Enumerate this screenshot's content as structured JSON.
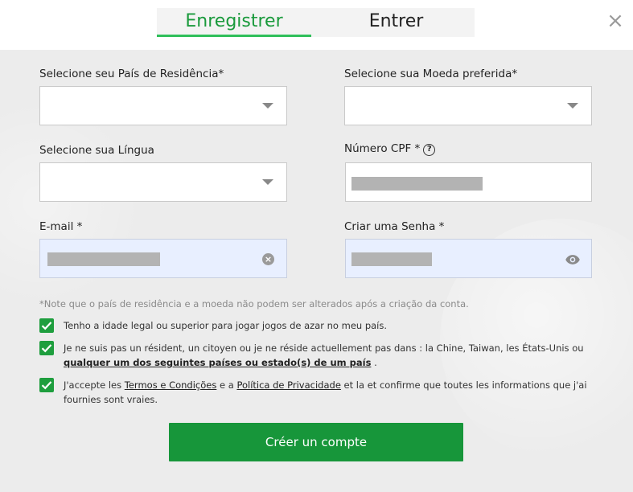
{
  "tabs": {
    "register": "Enregistrer",
    "login": "Entrer"
  },
  "close_symbol": "×",
  "form": {
    "country_label": "Selecione seu País de Residência*",
    "currency_label": "Selecione sua Moeda preferida*",
    "language_label": "Selecione sua Língua",
    "cpf_label": "Número CPF *",
    "cpf_help": "?",
    "email_label": "E-mail *",
    "password_label": "Criar uma Senha *",
    "clear_symbol": "×"
  },
  "note": "*Note que o país de residência e a moeda não podem ser alterados após a criação da conta.",
  "checks": {
    "age": "Tenho a idade legal ou superior para jogar jogos de azar no meu país.",
    "resident_prefix": "Je ne suis pas un résident, un citoyen ou je ne réside actuellement pas dans : la Chine, Taiwan, les États-Unis ou ",
    "resident_link": "qualquer um dos seguintes países ou estado(s) de um país",
    "resident_suffix": " .",
    "terms_prefix": "J'accepte les ",
    "terms_link": "Termos e Condições",
    "terms_middle": " e a ",
    "privacy_link": "Política de Privacidade",
    "terms_suffix": " et la et confirme que toutes les informations que j'ai fournies sont vraies."
  },
  "submit_label": "Créer un compte",
  "colors": {
    "accent": "#17963a",
    "tab_active": "#1a9a3c",
    "field_autofill": "#e8efff"
  }
}
